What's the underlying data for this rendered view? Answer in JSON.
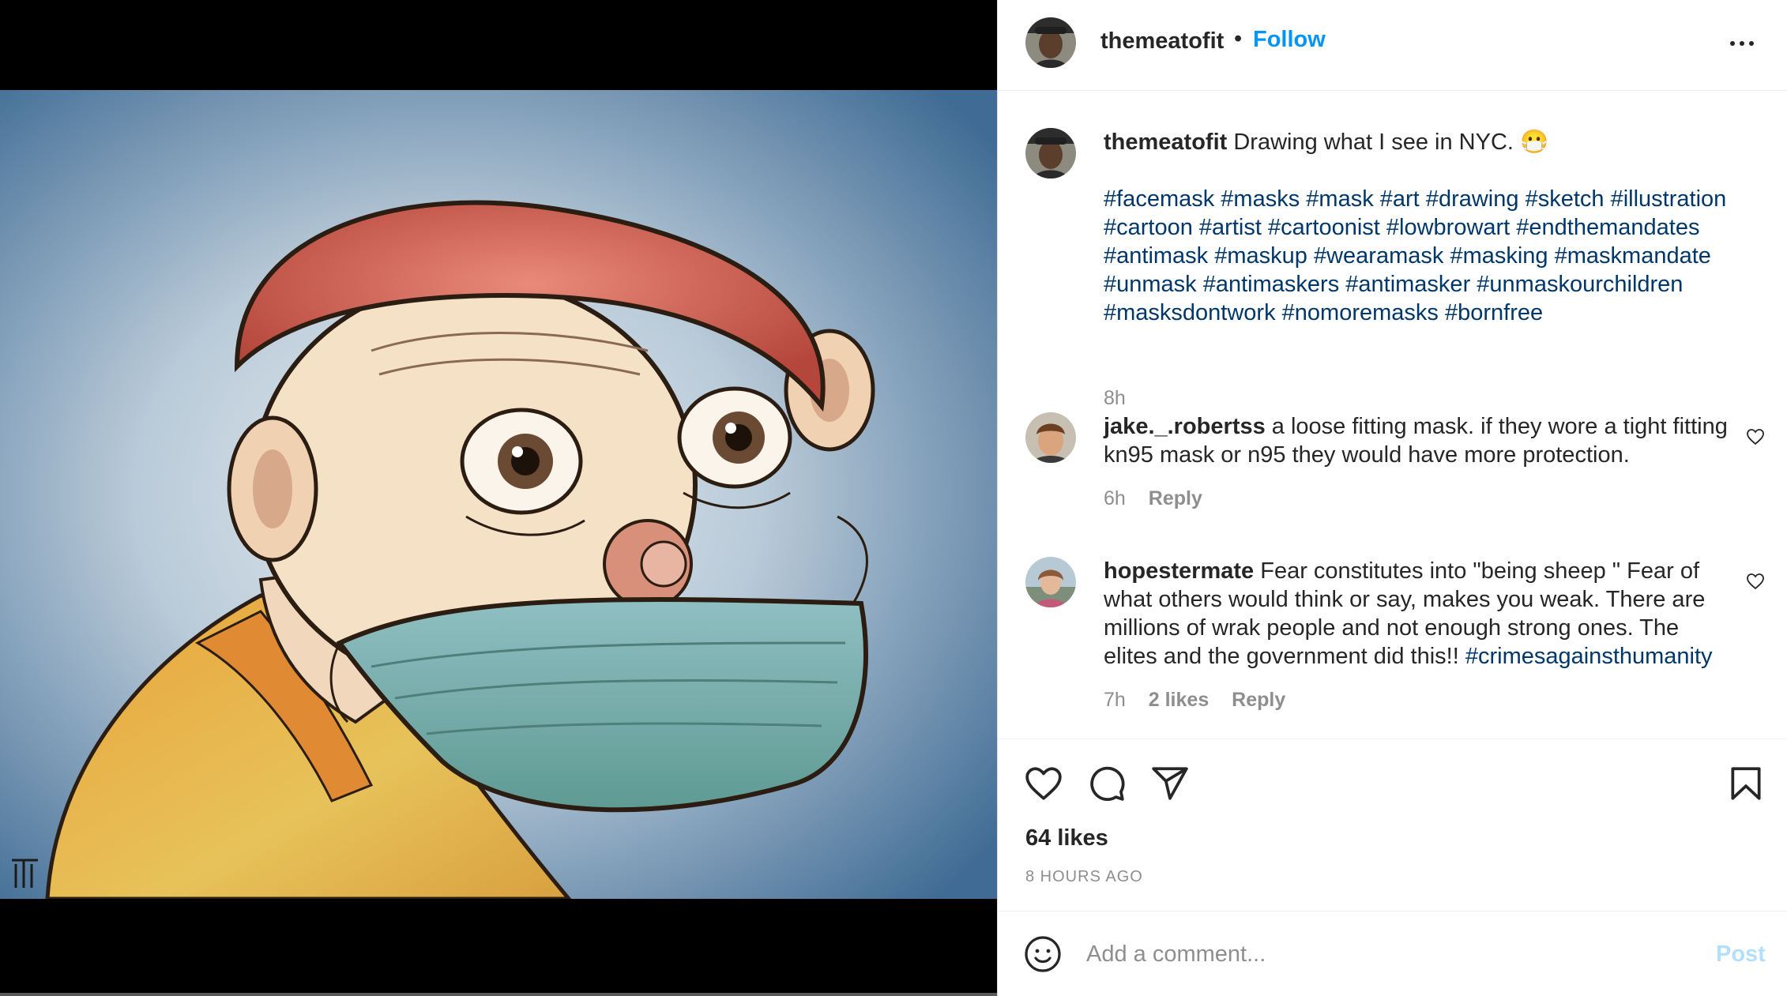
{
  "post": {
    "username": "themeatofit",
    "follow_label": "Follow",
    "dot": "•",
    "more_icon": "more-horizontal-icon"
  },
  "caption": {
    "username": "themeatofit",
    "text": "Drawing what I see in NYC.",
    "emoji": "😷",
    "hashtags": [
      "#facemask",
      "#masks",
      "#mask",
      "#art",
      "#drawing",
      "#sketch",
      "#illustration",
      "#cartoon",
      "#artist",
      "#cartoonist",
      "#lowbrowart",
      "#endthemandates",
      "#antimask",
      "#maskup",
      "#wearamask",
      "#masking",
      "#maskmandate",
      "#unmask",
      "#antimaskers",
      "#antimasker",
      "#unmaskourchildren",
      "#masksdontwork",
      "#nomoremasks",
      "#bornfree"
    ],
    "time": "8h"
  },
  "comments": [
    {
      "username": "jake._.robertss",
      "text": "a loose fitting mask. if they wore a tight fitting kn95 mask or n95 they would have more protection.",
      "time": "6h",
      "reply_label": "Reply"
    },
    {
      "username": "hopestermate",
      "text": "Fear constitutes into \"being sheep \" Fear of what others would think or say, makes you weak. There are millions of wrak people and not enough strong ones. The elites and the government did this!!",
      "hashtag": "#crimesagainsthumanity",
      "time": "7h",
      "likes": "2 likes",
      "reply_label": "Reply"
    }
  ],
  "actions": {
    "icons": [
      "heart-icon",
      "comment-icon",
      "share-icon",
      "bookmark-icon"
    ],
    "likes": "64 likes",
    "time_ago": "8 HOURS AGO"
  },
  "comment_box": {
    "placeholder": "Add a comment...",
    "post_label": "Post"
  },
  "colors": {
    "accent": "#0095f6",
    "hashtag": "#00376b",
    "muted": "#8e8e8e",
    "post_disabled": "#b2dffc"
  }
}
